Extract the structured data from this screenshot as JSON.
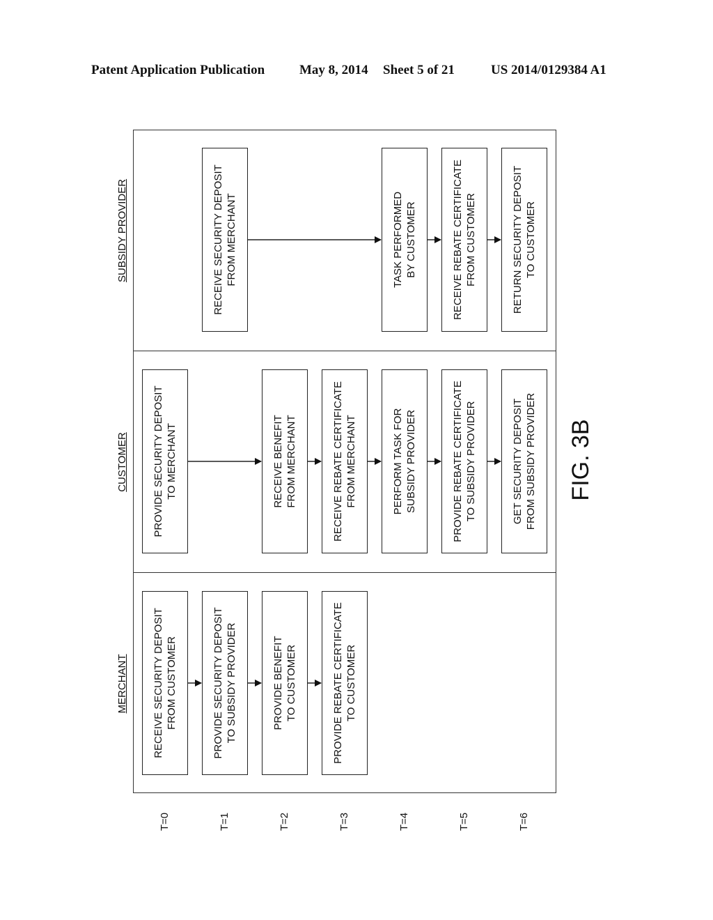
{
  "header": {
    "publication": "Patent Application Publication",
    "date": "May 8, 2014",
    "sheet": "Sheet 5 of 21",
    "number": "US 2014/0129384 A1"
  },
  "lanes": [
    {
      "label": "SUBSIDY PROVIDER"
    },
    {
      "label": "CUSTOMER"
    },
    {
      "label": "MERCHANT"
    }
  ],
  "time_labels": [
    "T=0",
    "T=1",
    "T=2",
    "T=3",
    "T=4",
    "T=5",
    "T=6"
  ],
  "steps": {
    "merchant": [
      {
        "t": 0,
        "line1": "RECEIVE SECURITY DEPOSIT",
        "line2": "FROM CUSTOMER"
      },
      {
        "t": 1,
        "line1": "PROVIDE SECURITY DEPOSIT",
        "line2": "TO SUBSIDY PROVIDER"
      },
      {
        "t": 2,
        "line1": "PROVIDE BENEFIT",
        "line2": "TO CUSTOMER"
      },
      {
        "t": 3,
        "line1": "PROVIDE REBATE CERTIFICATE",
        "line2": "TO CUSTOMER"
      }
    ],
    "customer": [
      {
        "t": 0,
        "line1": "PROVIDE SECURITY DEPOSIT",
        "line2": "TO MERCHANT"
      },
      {
        "t": 2,
        "line1": "RECEIVE BENEFIT",
        "line2": "FROM MERCHANT"
      },
      {
        "t": 3,
        "line1": "RECEIVE REBATE CERTIFICATE",
        "line2": "FROM MERCHANT"
      },
      {
        "t": 4,
        "line1": "PERFORM TASK FOR",
        "line2": "SUBSIDY PROVIDER"
      },
      {
        "t": 5,
        "line1": "PROVIDE REBATE CERTIFICATE",
        "line2": "TO SUBSIDY PROVIDER"
      },
      {
        "t": 6,
        "line1": "GET SECURITY DEPOSIT",
        "line2": "FROM SUBSIDY PROVIDER"
      }
    ],
    "subsidy_provider": [
      {
        "t": 1,
        "line1": "RECEIVE SECURITY DEPOSIT",
        "line2": "FROM MERCHANT"
      },
      {
        "t": 4,
        "line1": "TASK PERFORMED",
        "line2": "BY CUSTOMER"
      },
      {
        "t": 5,
        "line1": "RECEIVE REBATE CERTIFICATE",
        "line2": "FROM CUSTOMER"
      },
      {
        "t": 6,
        "line1": "RETURN SECURITY DEPOSIT",
        "line2": "TO CUSTOMER"
      }
    ]
  },
  "figure_label": "FIG. 3B"
}
